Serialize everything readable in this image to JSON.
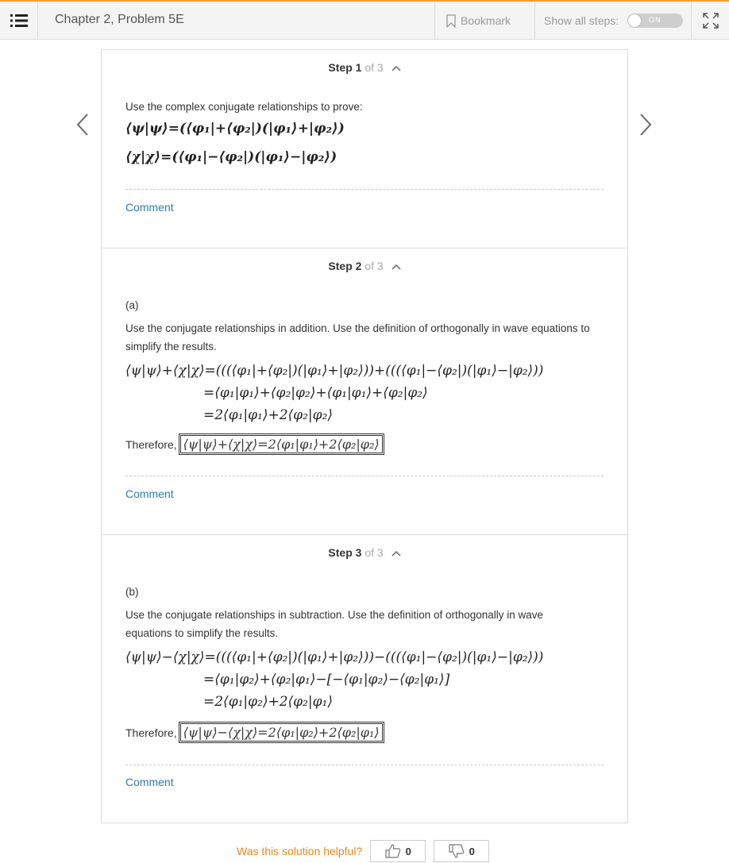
{
  "header": {
    "chapter_title": "Chapter 2, Problem 5E",
    "bookmark_label": "Bookmark",
    "show_steps_label": "Show all steps:",
    "toggle_state": "ON"
  },
  "steps": [
    {
      "num_label": "Step 1",
      "of_label": "of 3",
      "intro": "Use the complex conjugate relationships to prove:",
      "math_lines": [
        "⟨ψ|ψ⟩=(⟨φ₁|+⟨φ₂|)(|φ₁⟩+|φ₂⟩)",
        "⟨χ|χ⟩=(⟨φ₁|−⟨φ₂|)(|φ₁⟩−|φ₂⟩)"
      ],
      "comment": "Comment"
    },
    {
      "num_label": "Step 2",
      "of_label": "of 3",
      "part": "(a)",
      "intro": "Use the conjugate relationships in addition. Use the definition of orthogonally in wave equations to simplify the results.",
      "math_lines": [
        "⟨ψ|ψ⟩+⟨χ|χ⟩=(((⟨φ₁|+⟨φ₂|)(|φ₁⟩+|φ₂⟩))+(((⟨φ₁|−⟨φ₂|)(|φ₁⟩−|φ₂⟩))",
        "=⟨φ₁|φ₁⟩+⟨φ₂|φ₂⟩+⟨φ₁|φ₁⟩+⟨φ₂|φ₂⟩",
        "=2⟨φ₁|φ₁⟩+2⟨φ₂|φ₂⟩"
      ],
      "therefore_label": "Therefore,",
      "result": "⟨ψ|ψ⟩+⟨χ|χ⟩=2⟨φ₁|φ₁⟩+2⟨φ₂|φ₂⟩",
      "comment": "Comment"
    },
    {
      "num_label": "Step 3",
      "of_label": "of 3",
      "part": "(b)",
      "intro": "Use the conjugate relationships in subtraction. Use the definition of orthogonally in wave equations to simplify the results.",
      "math_lines": [
        "⟨ψ|ψ⟩−⟨χ|χ⟩=(((⟨φ₁|+⟨φ₂|)(|φ₁⟩+|φ₂⟩))−(((⟨φ₁|−⟨φ₂|)(|φ₁⟩−|φ₂⟩))",
        "=⟨φ₁|φ₂⟩+⟨φ₂|φ₁⟩−[−⟨φ₁|φ₂⟩−⟨φ₂|φ₁⟩]",
        "=2⟨φ₁|φ₂⟩+2⟨φ₂|φ₁⟩"
      ],
      "therefore_label": "Therefore,",
      "result": "⟨ψ|ψ⟩−⟨χ|χ⟩=2⟨φ₁|φ₂⟩+2⟨φ₂|φ₁⟩",
      "comment": "Comment"
    }
  ],
  "footer": {
    "helpful_label": "Was this solution helpful?",
    "upvotes": "0",
    "downvotes": "0"
  },
  "colors": {
    "accent": "#f29d36",
    "link": "#2b7ca8",
    "helpful": "#e8871e"
  },
  "icons": [
    "menu-icon",
    "bookmark-icon",
    "expand-icon",
    "chevron-left-icon",
    "chevron-right-icon",
    "chevron-up-icon",
    "thumbs-up-icon",
    "thumbs-down-icon"
  ]
}
